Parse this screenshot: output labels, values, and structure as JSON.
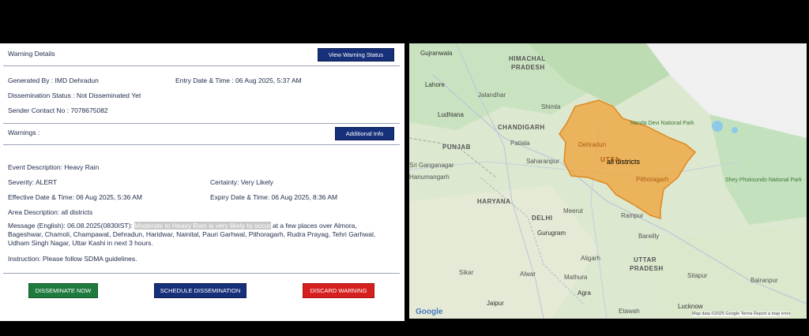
{
  "warning_panel": {
    "header": "Warning Details",
    "view_status_button": "View Warning Status",
    "generated_by": "Generated By : IMD Dehradun",
    "entry_date": "Entry Date & Time : 06 Aug 2025, 5:37 AM",
    "dissemination_status": "Dissemination Status : Not Disseminated Yet",
    "sender_contact": "Sender Contact No : 7078675082",
    "warnings_label": "Warnings :",
    "additional_info_button": "Additional Info",
    "event_description": "Event Description: Heavy Rain",
    "severity": "Severity: ALERT",
    "certainty": "Certainty: Very Likely",
    "effective_date": "Effective Date & Time: 06 Aug 2025, 5:36 AM",
    "expiry_date": "Expiry Date & Time: 06 Aug 2025, 8:36 AM",
    "area_description": "Area Description: all districts",
    "message_prefix": "Message (English): 06.08.2025(0830IST): ",
    "message_highlight": "Moderate to Heavy Rain is very likely to occur",
    "message_rest": " at a few places over Almora, Bageshwar, Chamoli, Champawat, Dehradun, Haridwar, Nainital, Pauri Garhwal, Pithoragarh, Rudra Prayag, Tehri Garhwal, Udham Singh Nagar, Uttar Kashi in next 3 hours.",
    "instruction": "Instruction: Please follow SDMA guidelines.",
    "disseminate_button": "DISSEMINATE NOW",
    "schedule_button": "SCHEDULE DISSEMINATION",
    "discard_button": "DISCARD WARNING"
  },
  "map": {
    "region_label": "all districts",
    "labels": {
      "gujranwala": "Gujranwala",
      "himachal": "HIMACHAL",
      "pradesh1": "PRADESH",
      "lahore": "Lahore",
      "jalandhar": "Jalandhar",
      "ludhiana": "Ludhiana",
      "shimla": "Shimla",
      "chandigarh": "CHANDIGARH",
      "punjab": "PUNJAB",
      "patiala": "Patiala",
      "dehradun": "Dehradun",
      "saharanpur": "Saharanpur",
      "nanda": "Nanda Devi National Park",
      "pithoragarh": "Pithoragarh",
      "shey": "Shey Phoksundo National Park",
      "ganganagar": "Sri Ganganagar",
      "hanumangarh": "Hanumangarh",
      "haryana": "HARYANA",
      "delhi": "DELHI",
      "meerut": "Meerut",
      "rampur": "Rampur",
      "bareilly": "Bareilly",
      "gurugram": "Gurugram",
      "aligarh": "Aligarh",
      "uttar": "UTTAR",
      "pradesh2": "PRADESH",
      "sikar": "Sikar",
      "alwar": "Alwar",
      "mathura": "Mathura",
      "agra": "Agra",
      "jaipur": "Jaipur",
      "sitapur": "Sitapur",
      "bairanpur": "Bairanpur",
      "lucknow": "Lucknow",
      "uttara": "UTTA",
      "etawah": "Etawah"
    },
    "attribution": "Map data ©2025 Google   Terms   Report a map error",
    "logo": "Google"
  }
}
